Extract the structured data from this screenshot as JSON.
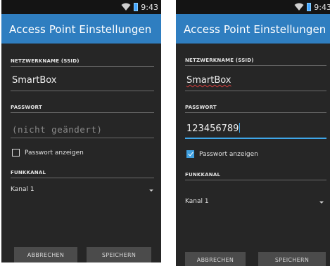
{
  "left": {
    "status": {
      "time": "9:43"
    },
    "title": "Access Point Einstellungen",
    "ssid_label": "NETZWERKNAME (SSID)",
    "ssid_value": "SmartBox",
    "password_label": "PASSWORT",
    "password_placeholder": "(nicht geändert)",
    "show_password_label": "Passwort anzeigen",
    "show_password_checked": false,
    "channel_label": "FUNKKANAL",
    "channel_value": "Kanal 1",
    "cancel_label": "ABBRECHEN",
    "save_label": "SPEICHERN"
  },
  "right": {
    "status": {
      "time": "9:43"
    },
    "title": "Access Point Einstellungen",
    "ssid_label": "NETZWERKNAME (SSID)",
    "ssid_value": "SmartBox",
    "password_label": "PASSWORT",
    "password_value": "123456789",
    "show_password_label": "Passwort anzeigen",
    "show_password_checked": true,
    "channel_label": "FUNKKANAL",
    "channel_value": "Kanal 1",
    "cancel_label": "ABBRECHEN",
    "save_label": "SPEICHERN"
  },
  "colors": {
    "appbar": "#2f7ec0",
    "background": "#262626",
    "focus_accent": "#3fa6e8",
    "button": "#4b4b4b"
  },
  "icons": [
    "wifi-icon",
    "battery-icon",
    "checkbox-icon",
    "dropdown-arrow-icon"
  ]
}
